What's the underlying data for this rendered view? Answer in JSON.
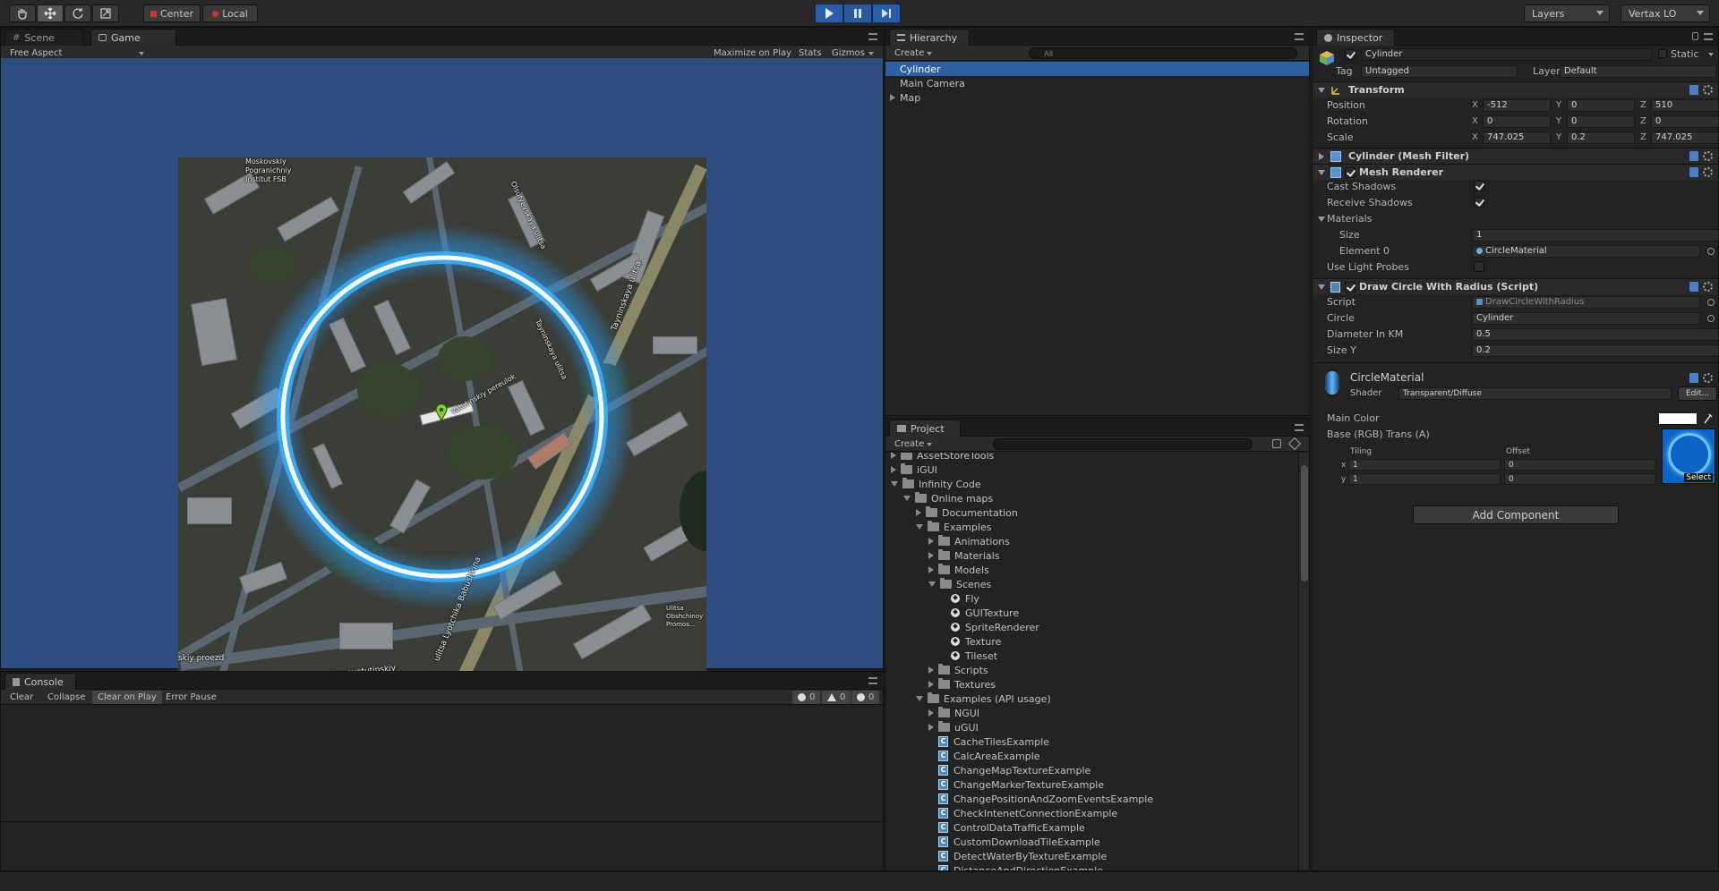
{
  "toolbar": {
    "tools": [
      "hand-tool",
      "move-tool",
      "rotate-tool",
      "scale-tool"
    ],
    "pivot_label": "Center",
    "space_label": "Local",
    "layers_label": "Layers",
    "layout_label": "Vertax LO"
  },
  "game": {
    "tab_scene": "Scene",
    "tab_game": "Game",
    "aspect": "Free Aspect",
    "maximize": "Maximize on Play",
    "stats": "Stats",
    "gizmos": "Gizmos",
    "map_labels": {
      "institute": "Moskovskiy\nPogranichniy\nInstitut FSB",
      "street1": "Tayninskaya ulitsa",
      "street2": "Vatutinskiy pereulok",
      "street3": "ulitsa Lyotchika Babushkina",
      "street4": "Starovatutinskiy",
      "street5": "skiy proezd",
      "street6": "Olsufyevskaya ulitsa",
      "street7": "Tayninskaya ulitsa",
      "park": "Ulitsa\nObshchinoy\nPromos..."
    }
  },
  "console": {
    "tab": "Console",
    "buttons": [
      "Clear",
      "Collapse",
      "Clear on Play",
      "Error Pause"
    ],
    "counts": [
      "0",
      "0",
      "0"
    ]
  },
  "hierarchy": {
    "tab": "Hierarchy",
    "create": "Create",
    "search_placeholder": "All",
    "items": [
      "Cylinder",
      "Main Camera",
      "Map"
    ]
  },
  "project": {
    "tab": "Project",
    "create": "Create",
    "tree": [
      {
        "label": "AssetStoreTools",
        "depth": 0,
        "kind": "folder",
        "arrow": "r"
      },
      {
        "label": "iGUI",
        "depth": 0,
        "kind": "folder",
        "arrow": "r"
      },
      {
        "label": "Infinity Code",
        "depth": 0,
        "kind": "folder",
        "arrow": "d"
      },
      {
        "label": "Online maps",
        "depth": 1,
        "kind": "folder",
        "arrow": "d"
      },
      {
        "label": "Documentation",
        "depth": 2,
        "kind": "folder",
        "arrow": "r"
      },
      {
        "label": "Examples",
        "depth": 2,
        "kind": "folder",
        "arrow": "d"
      },
      {
        "label": "Animations",
        "depth": 3,
        "kind": "folder",
        "arrow": "r"
      },
      {
        "label": "Materials",
        "depth": 3,
        "kind": "folder",
        "arrow": "r"
      },
      {
        "label": "Models",
        "depth": 3,
        "kind": "folder",
        "arrow": "r"
      },
      {
        "label": "Scenes",
        "depth": 3,
        "kind": "folder",
        "arrow": "d"
      },
      {
        "label": "Fly",
        "depth": 4,
        "kind": "scene",
        "arrow": ""
      },
      {
        "label": "GUITexture",
        "depth": 4,
        "kind": "scene",
        "arrow": ""
      },
      {
        "label": "SpriteRenderer",
        "depth": 4,
        "kind": "scene",
        "arrow": ""
      },
      {
        "label": "Texture",
        "depth": 4,
        "kind": "scene",
        "arrow": ""
      },
      {
        "label": "Tileset",
        "depth": 4,
        "kind": "scene",
        "arrow": ""
      },
      {
        "label": "Scripts",
        "depth": 3,
        "kind": "folder",
        "arrow": "r"
      },
      {
        "label": "Textures",
        "depth": 3,
        "kind": "folder",
        "arrow": "r"
      },
      {
        "label": "Examples (API usage)",
        "depth": 2,
        "kind": "folder",
        "arrow": "d"
      },
      {
        "label": "NGUI",
        "depth": 3,
        "kind": "folder",
        "arrow": "r"
      },
      {
        "label": "uGUI",
        "depth": 3,
        "kind": "folder",
        "arrow": "r"
      },
      {
        "label": "CacheTilesExample",
        "depth": 3,
        "kind": "script",
        "arrow": ""
      },
      {
        "label": "CalcAreaExample",
        "depth": 3,
        "kind": "script",
        "arrow": ""
      },
      {
        "label": "ChangeMapTextureExample",
        "depth": 3,
        "kind": "script",
        "arrow": ""
      },
      {
        "label": "ChangeMarkerTextureExample",
        "depth": 3,
        "kind": "script",
        "arrow": ""
      },
      {
        "label": "ChangePositionAndZoomEventsExample",
        "depth": 3,
        "kind": "script",
        "arrow": ""
      },
      {
        "label": "CheckIntenetConnectionExample",
        "depth": 3,
        "kind": "script",
        "arrow": ""
      },
      {
        "label": "ControlDataTrafficExample",
        "depth": 3,
        "kind": "script",
        "arrow": ""
      },
      {
        "label": "CustomDownloadTileExample",
        "depth": 3,
        "kind": "script",
        "arrow": ""
      },
      {
        "label": "DetectWaterByTextureExample",
        "depth": 3,
        "kind": "script",
        "arrow": ""
      },
      {
        "label": "DistanceAndDirectionExample",
        "depth": 3,
        "kind": "script",
        "arrow": ""
      }
    ]
  },
  "inspector": {
    "tab": "Inspector",
    "object_name": "Cylinder",
    "static_label": "Static",
    "tag_label": "Tag",
    "tag_value": "Untagged",
    "layer_label": "Layer",
    "layer_value": "Default",
    "transform": {
      "title": "Transform",
      "position_label": "Position",
      "rotation_label": "Rotation",
      "scale_label": "Scale",
      "position": {
        "x": "-512",
        "y": "0",
        "z": "510"
      },
      "rotation": {
        "x": "0",
        "y": "0",
        "z": "0"
      },
      "scale": {
        "x": "747.025",
        "y": "0.2",
        "z": "747.025"
      }
    },
    "mesh_filter": {
      "title": "Cylinder (Mesh Filter)"
    },
    "mesh_renderer": {
      "title": "Mesh Renderer",
      "cast_shadows": "Cast Shadows",
      "receive_shadows": "Receive Shadows",
      "materials": "Materials",
      "size_label": "Size",
      "size_value": "1",
      "element0_label": "Element 0",
      "element0_value": "CircleMaterial",
      "light_probes": "Use Light Probes"
    },
    "script": {
      "title": "Draw Circle With Radius (Script)",
      "script_label": "Script",
      "script_value": "DrawCircleWithRadius",
      "circle_label": "Circle",
      "circle_value": "Cylinder",
      "diameter_label": "Diameter In KM",
      "diameter_value": "0.5",
      "sizey_label": "Size Y",
      "sizey_value": "0.2"
    },
    "material": {
      "name": "CircleMaterial",
      "shader_label": "Shader",
      "shader_value": "Transparent/Diffuse",
      "edit": "Edit...",
      "main_color": "Main Color",
      "base": "Base (RGB) Trans (A)",
      "tiling": "Tiling",
      "offset": "Offset",
      "x_label": "x",
      "y_label": "y",
      "tiling_x": "1",
      "tiling_y": "1",
      "offset_x": "0",
      "offset_y": "0",
      "select": "Select"
    },
    "add_component": "Add Component"
  },
  "colors": {
    "accent": "#2f5fa3",
    "game_bg": "#2f4d7e",
    "circle": "#5fc8ff"
  }
}
